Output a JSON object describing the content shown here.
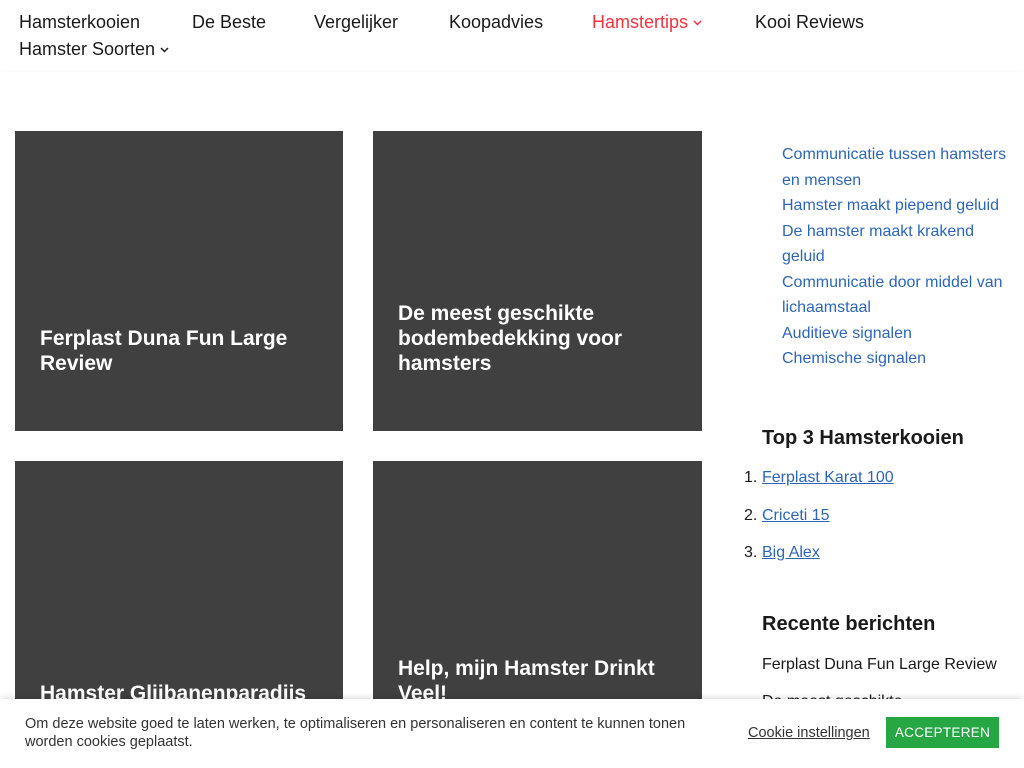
{
  "nav": {
    "items": [
      {
        "label": "Hamsterkooien"
      },
      {
        "label": "De Beste"
      },
      {
        "label": "Vergelijker"
      },
      {
        "label": "Koopadvies"
      },
      {
        "label": "Hamstertips",
        "active": true,
        "dropdown": true
      },
      {
        "label": "Kooi Reviews"
      },
      {
        "label": "Hamster Soorten",
        "dropdown": true
      }
    ],
    "active_color": "#ef3340"
  },
  "posts": [
    {
      "title": "Ferplast Duna Fun Large Review"
    },
    {
      "title": "De meest geschikte bodembedekking voor hamsters"
    },
    {
      "title": "Hamster Glijbanenparadijs"
    },
    {
      "title": "Help, mijn Hamster Drinkt Veel!"
    }
  ],
  "sidebar": {
    "toc": [
      "Communicatie tussen hamsters en mensen",
      "Hamster maakt piepend geluid",
      "De hamster maakt krakend geluid",
      "Communicatie door middel van lichaamstaal",
      "Auditieve signalen",
      "Chemische signalen"
    ],
    "top3_heading": "Top 3 Hamsterkooien",
    "top3": [
      {
        "num": "1.",
        "label": "Ferplast Karat 100"
      },
      {
        "num": "2.",
        "label": "Criceti 15"
      },
      {
        "num": "3.",
        "label": "Big Alex"
      }
    ],
    "recent_heading": "Recente berichten",
    "recent": [
      "Ferplast Duna Fun Large Review",
      "De meest geschikte"
    ]
  },
  "cookie": {
    "text": "Om deze website goed te laten werken, te optimaliseren en personaliseren en content te kunnen tonen worden cookies geplaatst.",
    "settings_label": "Cookie instellingen",
    "accept_label": "ACCEPTEREN",
    "accept_color": "#26a744"
  },
  "colors": {
    "card_bg": "#404040",
    "link": "#2e66b5"
  }
}
